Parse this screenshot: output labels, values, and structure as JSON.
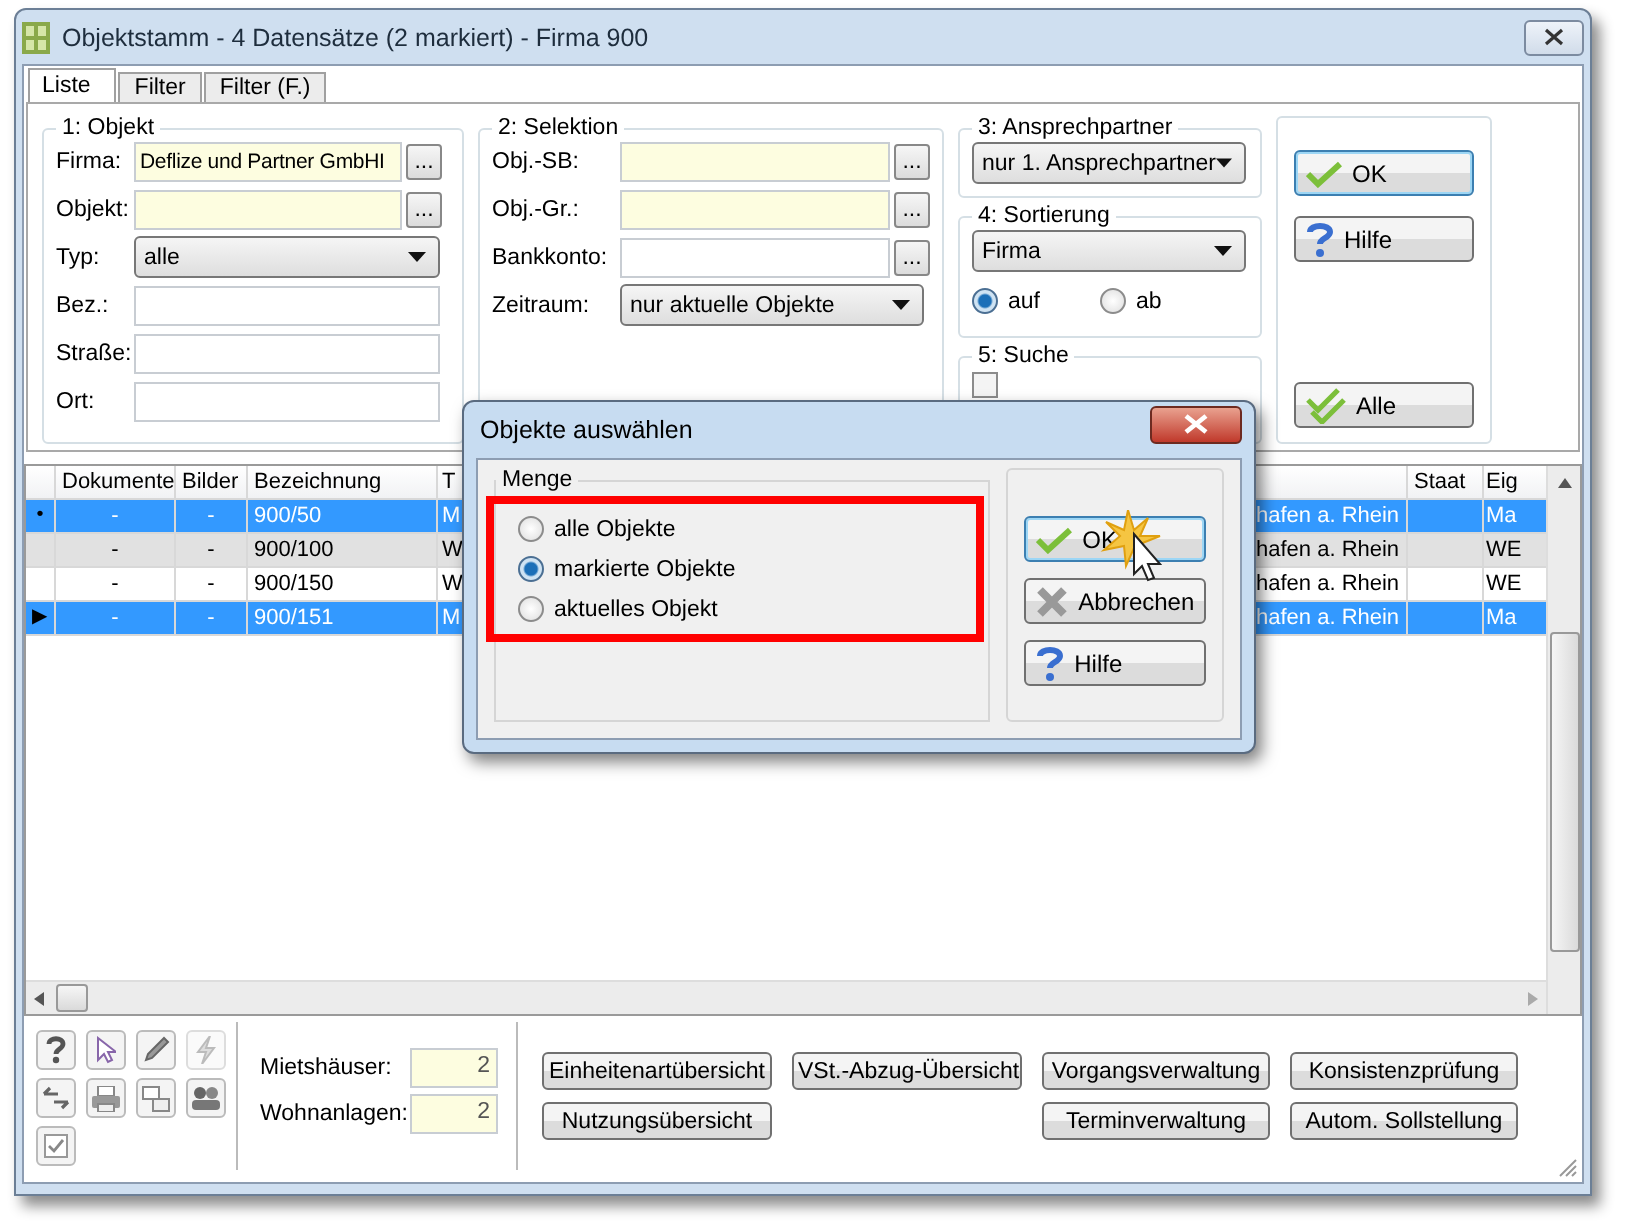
{
  "window": {
    "title": "Objektstamm - 4 Datensätze (2 markiert) - Firma 900"
  },
  "tabs": [
    {
      "label": "Liste",
      "selected": true
    },
    {
      "label": "Filter",
      "selected": false
    },
    {
      "label": "Filter (F.)",
      "selected": false
    }
  ],
  "objekt": {
    "legend": "1: Objekt",
    "fields": [
      {
        "kind": "lookup",
        "label": "Firma:",
        "value": "Deflize und Partner GmbHI",
        "button": "...",
        "required": true
      },
      {
        "kind": "lookup",
        "label": "Objekt:",
        "button": "...",
        "required": true
      },
      {
        "kind": "select",
        "label": "Typ:",
        "value": "alle"
      },
      {
        "kind": "text",
        "label": "Bez.:",
        "required": false
      },
      {
        "kind": "text",
        "label": "Straße:",
        "required": false
      },
      {
        "kind": "text",
        "label": "Ort:",
        "required": false
      }
    ]
  },
  "selektion": {
    "legend": "2: Selektion",
    "fields": [
      {
        "kind": "lookup",
        "label": "Obj.-SB:",
        "button": "...",
        "required": true
      },
      {
        "kind": "lookup",
        "label": "Obj.-Gr.:",
        "button": "...",
        "required": true
      },
      {
        "kind": "lookup",
        "label": "Bankkonto:",
        "button": "...",
        "required": false
      },
      {
        "kind": "select",
        "label": "Zeitraum:",
        "value": "nur aktuelle Objekte"
      }
    ]
  },
  "ansprechpartner": {
    "legend": "3: Ansprechpartner",
    "value": "nur 1. Ansprechpartner"
  },
  "sortierung": {
    "legend": "4: Sortierung",
    "value": "Firma",
    "order": [
      {
        "label": "auf",
        "selected": true
      },
      {
        "label": "ab",
        "selected": false
      }
    ]
  },
  "suche": {
    "legend": "5: Suche",
    "checked": false
  },
  "side_buttons": [
    {
      "kind": "ok",
      "label": "OK",
      "focused": true
    },
    {
      "kind": "help",
      "label": "Hilfe",
      "focused": false
    },
    {
      "kind": "all",
      "label": "Alle",
      "focused": false
    }
  ],
  "table": {
    "columns": {
      "dokumente": "Dokumente",
      "bilder": "Bilder",
      "bezeichnung": "Bezeichnung",
      "column_4": "T",
      "staat": "Staat",
      "eig": "Eig"
    },
    "rows": [
      {
        "marker": "•",
        "selected": true,
        "shaded": false,
        "dokumente": "-",
        "bilder": "-",
        "bezeichnung": "900/50",
        "column_4": "M",
        "column_5": "hafen a. Rhein",
        "eig": "Ma"
      },
      {
        "selected": false,
        "shaded": true,
        "dokumente": "-",
        "bilder": "-",
        "bezeichnung": "900/100",
        "column_4": "W",
        "column_5": "hafen a. Rhein",
        "eig": "WE"
      },
      {
        "selected": false,
        "shaded": false,
        "dokumente": "-",
        "bilder": "-",
        "bezeichnung": "900/150",
        "column_4": "W",
        "column_5": "hafen a. Rhein",
        "eig": "WE"
      },
      {
        "marker": "▶",
        "selected": true,
        "shaded": false,
        "dokumente": "-",
        "bilder": "-",
        "bezeichnung": "900/151",
        "column_4": "M",
        "column_5": "hafen a. Rhein",
        "eig": "Ma"
      }
    ]
  },
  "tools": [
    {
      "kind": "help",
      "disabled": false
    },
    {
      "kind": "pointer",
      "disabled": false
    },
    {
      "kind": "pencil",
      "disabled": false
    },
    {
      "kind": "lightning",
      "disabled": true
    },
    {
      "kind": "swap",
      "disabled": false
    },
    {
      "kind": "printer",
      "disabled": false
    },
    {
      "kind": "windows",
      "disabled": false
    },
    {
      "kind": "people",
      "disabled": false
    },
    {
      "kind": "check",
      "disabled": false
    }
  ],
  "stats": [
    {
      "label": "Mietshäuser:",
      "value": "2"
    },
    {
      "label": "Wohnanlagen:",
      "value": "2"
    }
  ],
  "actions_left": [
    "Einheitenartübersicht",
    "VSt.-Abzug-Übersicht",
    "Nutzungsübersicht"
  ],
  "actions_right": [
    "Vorgangsverwaltung",
    "Konsistenzprüfung",
    "Terminverwaltung",
    "Autom. Sollstellung"
  ],
  "dialog": {
    "title": "Objekte auswählen",
    "group": "Menge",
    "highlight": true,
    "options": [
      {
        "label": "alle Objekte",
        "selected": false
      },
      {
        "label": "markierte Objekte",
        "selected": true
      },
      {
        "label": "aktuelles Objekt",
        "selected": false
      }
    ],
    "buttons": [
      {
        "kind": "ok",
        "label": "OK",
        "focused": true
      },
      {
        "kind": "cancel",
        "label": "Abbrechen",
        "focused": false
      },
      {
        "kind": "help",
        "label": "Hilfe",
        "focused": false
      }
    ]
  }
}
